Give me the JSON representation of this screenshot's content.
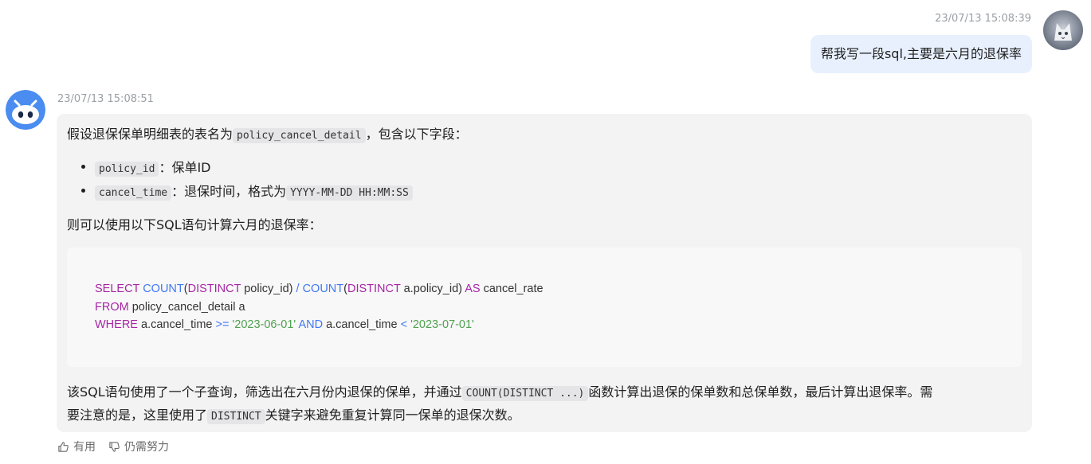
{
  "user_message": {
    "timestamp": "23/07/13 15:08:39",
    "text": "帮我写一段sql,主要是六月的退保率"
  },
  "bot_message": {
    "timestamp": "23/07/13 15:08:51",
    "intro_prefix": "假设退保保单明细表的表名为",
    "intro_code": "policy_cancel_detail",
    "intro_suffix": "，包含以下字段：",
    "fields": [
      {
        "code": "policy_id",
        "desc": "：保单ID"
      },
      {
        "code": "cancel_time",
        "desc": "：退保时间，格式为",
        "format": "YYYY-MM-DD HH:MM:SS"
      }
    ],
    "lead_in": "则可以使用以下SQL语句计算六月的退保率：",
    "sql": {
      "l1": {
        "kw1": "SELECT",
        "fn1": "COUNT",
        "p1": "(",
        "kw2": "DISTINCT",
        "t1": " policy_id) ",
        "op1": "/",
        "t2": " ",
        "fn2": "COUNT",
        "p2": "(",
        "kw3": "DISTINCT",
        "t3": " a.policy_id) ",
        "kw4": "AS",
        "t4": " cancel_rate"
      },
      "l2": {
        "kw1": "FROM",
        "t1": " policy_cancel_detail a"
      },
      "l3": {
        "kw1": "WHERE",
        "t1": " a.cancel_time ",
        "op1": ">=",
        "t2": " ",
        "s1": "'2023-06-01'",
        "t3": " ",
        "kw2": "AND",
        "t4": " a.cancel_time ",
        "op2": "<",
        "t5": " ",
        "s2": "'2023-07-01'"
      }
    },
    "explain_1": "该SQL语句使用了一个子查询，筛选出在六月份内退保的保单，并通过",
    "explain_code_1": "COUNT(DISTINCT ...)",
    "explain_2": "函数计算出退保的保单数和总保单数，最后计算出退保率。需",
    "explain_3": "要注意的是，这里使用了",
    "explain_code_2": "DISTINCT",
    "explain_4": "关键字来避免重复计算同一保单的退保次数。"
  },
  "actions": {
    "useful_label": "有用",
    "improve_label": "仍需努力"
  },
  "colors": {
    "user_bubble": "#e8f0fe",
    "bot_bubble": "#f3f3f4",
    "sql_keyword": "#a626a4",
    "sql_function": "#4078f2",
    "sql_string": "#50a14f"
  }
}
